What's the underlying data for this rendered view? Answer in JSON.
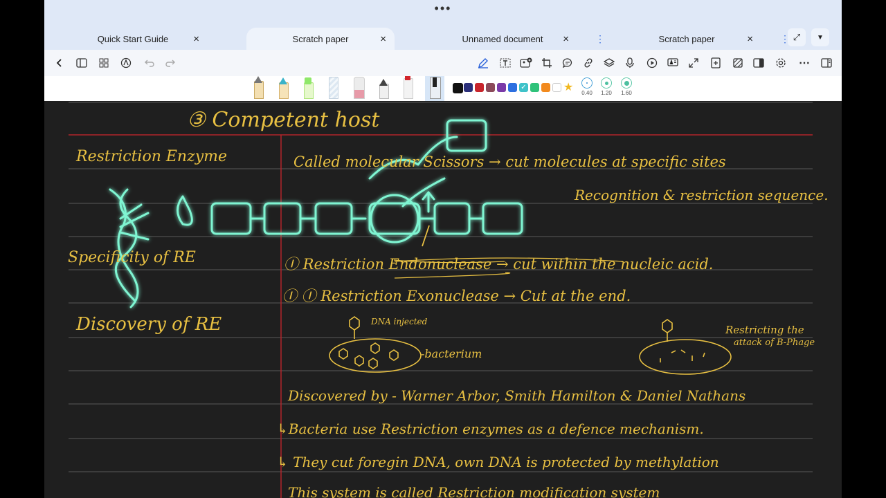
{
  "window": {
    "more_dots": "•••"
  },
  "tabs": [
    {
      "label": "Quick Start Guide",
      "close": "×"
    },
    {
      "label": "Scratch paper",
      "close": "×"
    },
    {
      "label": "Unnamed document",
      "close": "×"
    },
    {
      "label": "Scratch paper",
      "close": "×"
    }
  ],
  "tab_controls": {
    "expand": "⤢",
    "dropdown": "▼",
    "separator": "⋮"
  },
  "toolbar_icons": [
    "back-icon",
    "sidebar-icon",
    "grid-icon",
    "navigate-icon",
    "undo-icon",
    "redo-icon",
    "pen-icon",
    "text-icon",
    "image-icon",
    "crop-icon",
    "comment-icon",
    "link-icon",
    "layers-icon",
    "mic-icon",
    "play-icon",
    "read-aloud-icon",
    "expand-icon",
    "add-page-icon",
    "pattern-icon",
    "split-view-icon",
    "settings-icon",
    "more-icon",
    "layout-icon"
  ],
  "pen_tools": [
    "fountain-pen",
    "ballpoint-pen",
    "highlighter",
    "pencil",
    "eraser",
    "brush",
    "marker",
    "laser-pointer"
  ],
  "colors": [
    "#111111",
    "#2b2f7a",
    "#c8252c",
    "#8b4a5a",
    "#7a3aa8",
    "#2d6fe0",
    "#3fc2c9",
    "#f28a1e",
    "#f4e32a",
    "#ffffff"
  ],
  "thickness": [
    {
      "label": "0.40"
    },
    {
      "label": "1.20"
    },
    {
      "label": "1.60"
    }
  ],
  "notes": {
    "heading": "③ Competent host",
    "left": {
      "re": "Restriction Enzyme",
      "specificity": "Specificity of RE",
      "discovery": "Discovery of RE"
    },
    "right": {
      "line1": "Called molecular Scissors → cut molecules at specific sites",
      "line2": "Recognition & restriction sequence.",
      "line3": "Ⓘ Restriction Endonuclease → cut within the nucleic acid.",
      "line4": "Ⓘ Ⓘ Restriction Exonuclease → Cut at the end.",
      "dna_injected": "DNA injected",
      "bacterium": "-bacterium",
      "restricting": "Restricting the",
      "attack": "attack of B-Phage",
      "discovered": "Discovered by - Warner Arbor, Smith Hamilton & Daniel Nathans",
      "bacteria_use": "↳Bacteria use Restriction enzymes as a defence mechanism.",
      "they_cut": "↳ They cut foregin DNA, own DNA is protected by methylation",
      "this_system": "This system is called Restriction modification system"
    }
  }
}
